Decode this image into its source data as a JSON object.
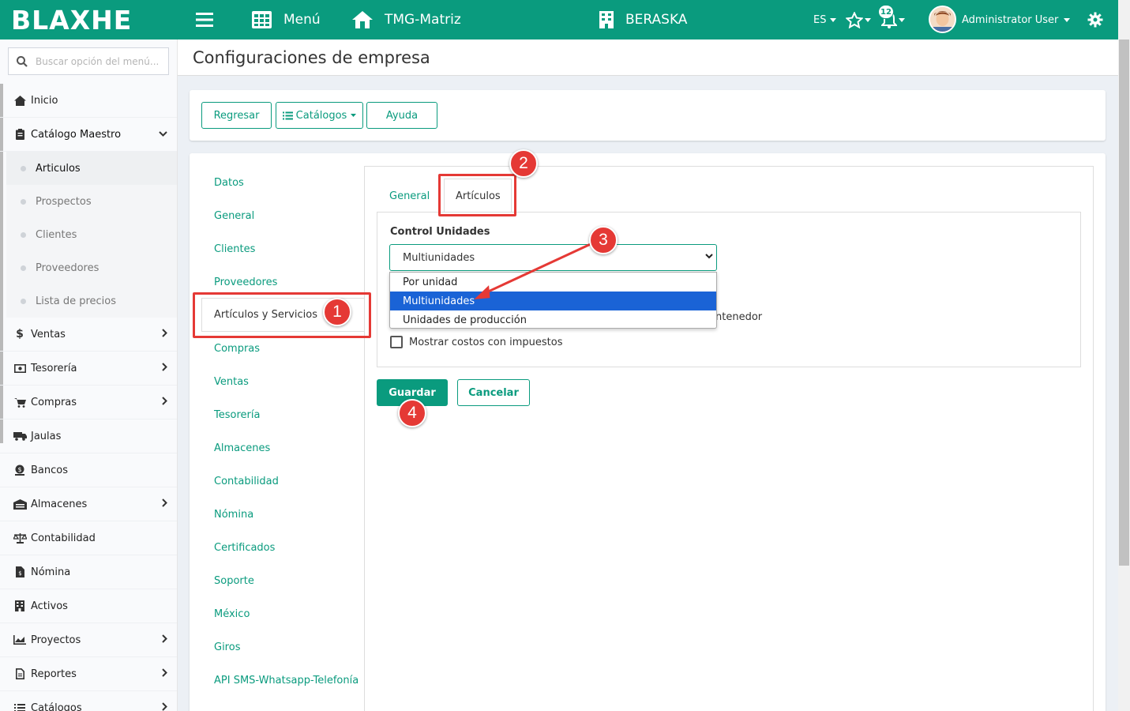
{
  "topbar": {
    "logo": "BLAXHE",
    "menu_label": "Menú",
    "branch_label": "TMG-Matriz",
    "company_label": "BERASKA",
    "language": "ES",
    "notifications_count": "12",
    "user_name": "Administrator User"
  },
  "sidebar": {
    "search_placeholder": "Buscar opción del menú...",
    "items": [
      {
        "label": "Inicio",
        "icon": "home-icon"
      },
      {
        "label": "Catálogo Maestro",
        "icon": "clipboard-icon"
      },
      {
        "label": "Ventas",
        "icon": "dollar-icon"
      },
      {
        "label": "Tesorería",
        "icon": "money-icon"
      },
      {
        "label": "Compras",
        "icon": "cart-icon"
      },
      {
        "label": "Jaulas",
        "icon": "truck-icon"
      },
      {
        "label": "Bancos",
        "icon": "bank-icon"
      },
      {
        "label": "Almacenes",
        "icon": "warehouse-icon"
      },
      {
        "label": "Contabilidad",
        "icon": "scale-icon"
      },
      {
        "label": "Nómina",
        "icon": "file-icon"
      },
      {
        "label": "Activos",
        "icon": "building-icon"
      },
      {
        "label": "Proyectos",
        "icon": "chart-icon"
      },
      {
        "label": "Reportes",
        "icon": "report-icon"
      },
      {
        "label": "Catálogos",
        "icon": "list-icon"
      }
    ],
    "sub_items": [
      "Articulos",
      "Prospectos",
      "Clientes",
      "Proveedores",
      "Lista de precios"
    ]
  },
  "page": {
    "title": "Configuraciones de empresa"
  },
  "toolbar": {
    "back_label": "Regresar",
    "catalogs_label": "Catálogos",
    "help_label": "Ayuda"
  },
  "config_nav": [
    "Datos",
    "General",
    "Clientes",
    "Proveedores",
    "Artículos y Servicios",
    "Compras",
    "Ventas",
    "Tesorería",
    "Almacenes",
    "Contabilidad",
    "Nómina",
    "Certificados",
    "Soporte",
    "México",
    "Giros",
    "API SMS-Whatsapp-Telefonía"
  ],
  "tabs": {
    "general": "General",
    "articulos": "Artículos"
  },
  "form": {
    "control_label": "Control Unidades",
    "selected_value": "Multiunidades",
    "options": [
      "Por unidad",
      "Multiunidades",
      "Unidades de producción"
    ],
    "hidden_label_tail": "ntenedor",
    "checkbox_label": "Mostrar costos con impuestos",
    "save_label": "Guardar",
    "cancel_label": "Cancelar"
  },
  "annotations": {
    "step1": "1",
    "step2": "2",
    "step3": "3",
    "step4": "4",
    "color": "#e53935"
  },
  "colors": {
    "brand": "#0a9b7e",
    "selection": "#1a63d6"
  }
}
